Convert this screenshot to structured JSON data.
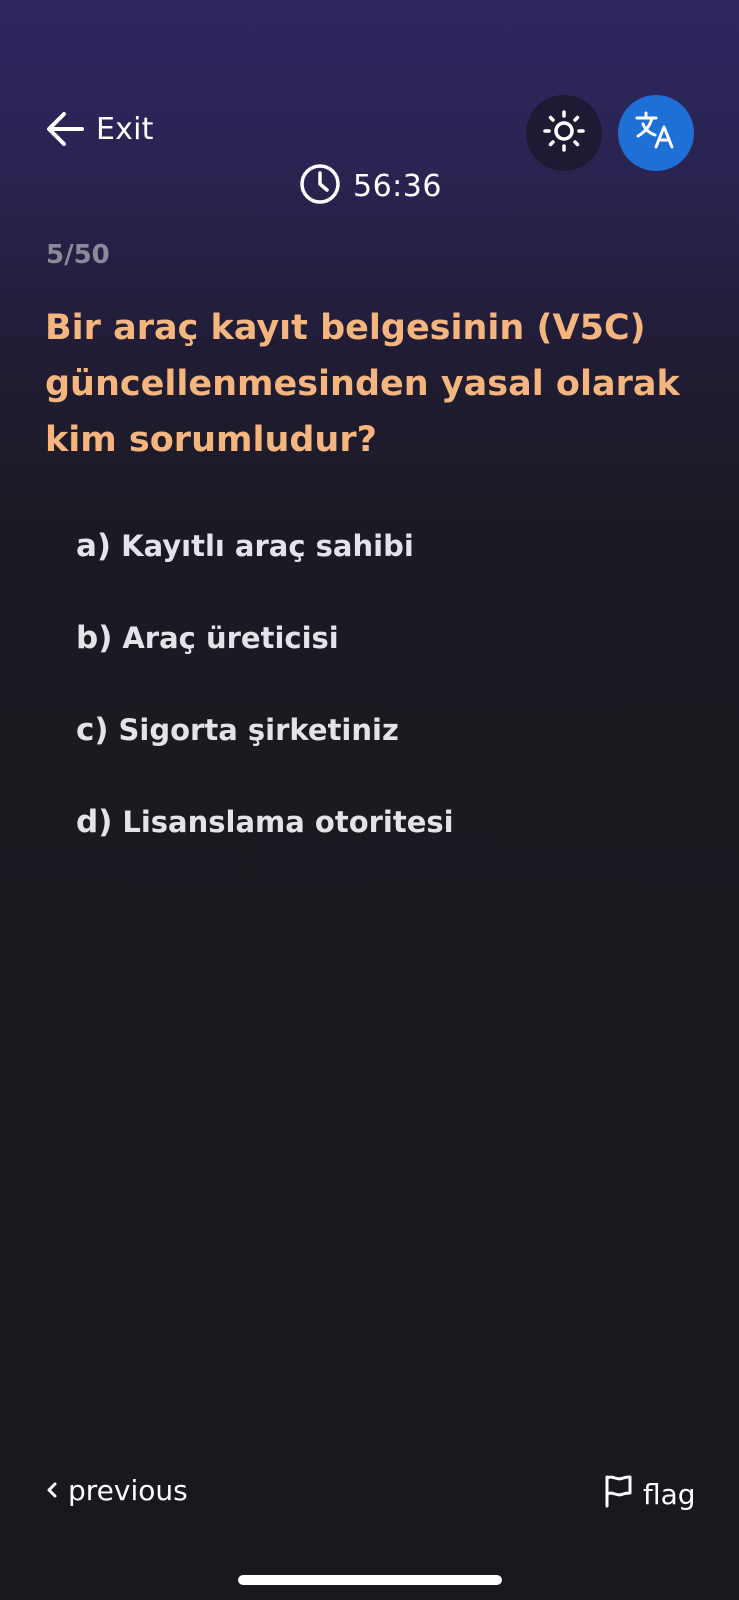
{
  "header": {
    "exit_label": "Exit",
    "theme_icon": "sun-icon",
    "translate_icon": "translate-icon",
    "timer": "56:36"
  },
  "progress": "5/50",
  "question": "Bir araç kayıt belgesinin (V5C) güncellenmesinden yasal olarak kim sorumludur?",
  "answers": [
    {
      "letter": "a)",
      "text": "Kayıtlı araç sahibi"
    },
    {
      "letter": "b)",
      "text": "Araç üreticisi"
    },
    {
      "letter": "c)",
      "text": "Sigorta şirketiniz"
    },
    {
      "letter": "d)",
      "text": "Lisanslama otoritesi"
    }
  ],
  "footer": {
    "previous_label": "previous",
    "flag_label": "flag"
  },
  "colors": {
    "question": "#f5b57e",
    "accent_blue": "#1f70d6",
    "progress": "#8c8a99"
  }
}
